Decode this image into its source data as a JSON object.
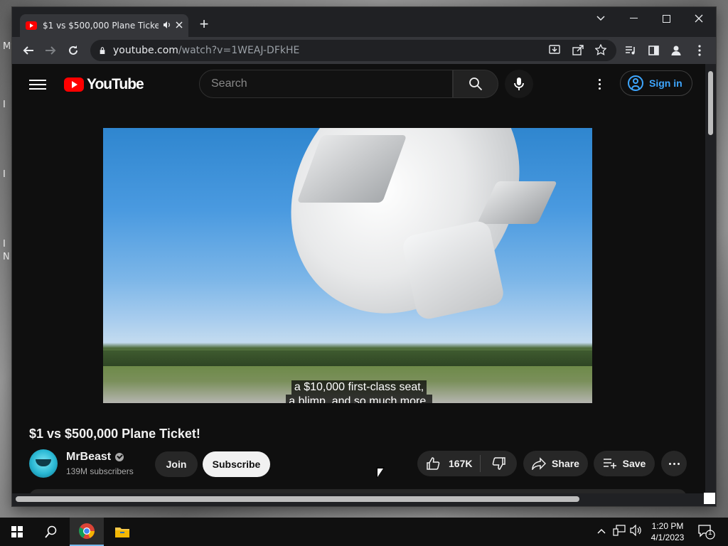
{
  "desktop": {
    "fragments": [
      "My",
      "I",
      "I",
      "I",
      "N"
    ]
  },
  "browser": {
    "tab": {
      "title": "$1 vs $500,000 Plane Ticket!",
      "audio_icon": "speaker-icon",
      "close_icon": "close-icon"
    },
    "new_tab_label": "+",
    "window_controls": [
      "chevron-down-icon",
      "minimize-icon",
      "maximize-icon",
      "close-icon"
    ],
    "url": {
      "host": "youtube.com",
      "path": "/watch?v=1WEAJ-DFkHE"
    },
    "toolbar_icons": [
      "back-icon",
      "forward-icon",
      "reload-icon",
      "install-icon",
      "share-icon",
      "star-icon",
      "media-icon",
      "sidepanel-icon",
      "profile-icon",
      "menu-icon"
    ]
  },
  "youtube": {
    "logo_text": "YouTube",
    "search": {
      "placeholder": "Search"
    },
    "signin_label": "Sign in",
    "caption": {
      "line1": "a $10,000 first-class seat,",
      "line2": "a blimp, and so much more."
    },
    "video": {
      "title": "$1 vs $500,000 Plane Ticket!",
      "channel": "MrBeast",
      "subscribers": "139M subscribers",
      "join_label": "Join",
      "subscribe_label": "Subscribe",
      "likes": "167K",
      "share_label": "Share",
      "save_label": "Save"
    }
  },
  "taskbar": {
    "time": "1:20 PM",
    "date": "4/1/2023",
    "notification_count": "1",
    "apps": [
      "start-icon",
      "search-icon",
      "chrome-icon",
      "file-explorer-icon"
    ]
  }
}
